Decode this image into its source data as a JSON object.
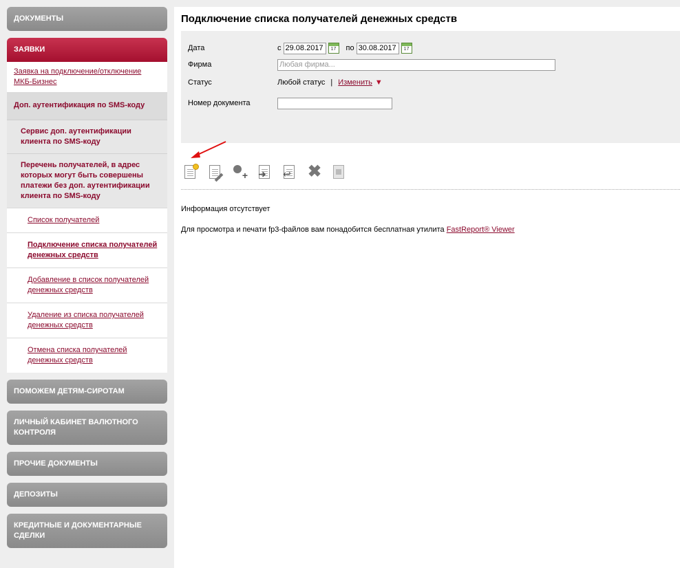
{
  "sidebar": {
    "documents": "ДОКУМЕНТЫ",
    "requests": "ЗАЯВКИ",
    "items": {
      "mkb": "Заявка на подключение/отключение МКБ-Бизнес",
      "sms": "Доп. аутентификация по SMS-коду",
      "service": "Сервис доп. аутентификации клиента по SMS-коду",
      "list": "Перечень получателей, в адрес которых могут быть совершены платежи без доп. аутентификации клиента по SMS-коду",
      "recipients": "Список получателей",
      "connect": "Подключение списка получателей денежных средств",
      "add": "Добавление в список получателей денежных средств",
      "remove": "Удаление из списка получателей денежных средств",
      "cancel": "Отмена списка получателей денежных средств"
    },
    "orphans": "ПОМОЖЕМ ДЕТЯМ-СИРОТАМ",
    "currency": "ЛИЧНЫЙ КАБИНЕТ ВАЛЮТНОГО КОНТРОЛЯ",
    "other": "ПРОЧИЕ ДОКУМЕНТЫ",
    "deposits": "ДЕПОЗИТЫ",
    "credit": "КРЕДИТНЫЕ И ДОКУМЕНТАРНЫЕ СДЕЛКИ"
  },
  "main": {
    "title": "Подключение списка получателей денежных средств",
    "filter": {
      "date_label": "Дата",
      "from_prefix": "с",
      "date_from": "29.08.2017",
      "to_prefix": "по",
      "date_to": "30.08.2017",
      "calendar_day": "17",
      "firm_label": "Фирма",
      "firm_placeholder": "Любая фирма...",
      "status_label": "Статус",
      "status_value": "Любой статус",
      "status_sep": "|",
      "status_change": "Изменить",
      "docnum_label": "Номер документа"
    },
    "info": "Информация отсутствует",
    "viewer_text": "Для просмотра и печати fp3-файлов вам понадобится бесплатная утилита",
    "viewer_link": "FastReport® Viewer"
  },
  "colors": {
    "accent": "#8b0a2d",
    "header_gray": "#999999",
    "header_active": "#b71c3c",
    "arrow": "#e01010"
  }
}
